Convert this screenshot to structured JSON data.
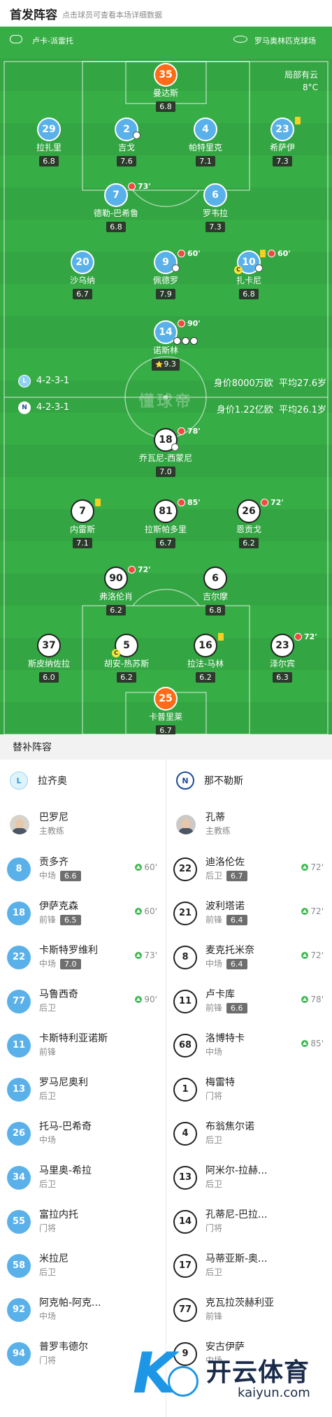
{
  "header": {
    "title": "首发阵容",
    "hint": "点击球员可查看本场详细数据"
  },
  "top_bar": {
    "coach_label": "卢卡-派雷托",
    "stadium_label": "罗马奥林匹克球场"
  },
  "weather": {
    "desc": "局部有云",
    "temp": "8°C"
  },
  "lazio_info": {
    "formation": "4-2-3-1",
    "value": "身价8000万欧",
    "age": "平均27.6岁"
  },
  "napoli_info": {
    "formation": "4-2-3-1",
    "value": "身价1.22亿欧",
    "age": "平均26.1岁"
  },
  "watermark": "懂球帝",
  "lazio_players": [
    {
      "num": "35",
      "name": "曼达斯",
      "rating": "6.8",
      "color": "orange"
    },
    {
      "num": "29",
      "name": "拉扎里",
      "rating": "6.8",
      "color": "blue"
    },
    {
      "num": "2",
      "name": "吉戈",
      "rating": "7.6",
      "color": "blue"
    },
    {
      "num": "4",
      "name": "帕特里克",
      "rating": "7.1",
      "color": "blue"
    },
    {
      "num": "23",
      "name": "希萨伊",
      "rating": "7.3",
      "color": "blue"
    },
    {
      "num": "7",
      "name": "德勒-巴希鲁",
      "rating": "6.8",
      "color": "blue",
      "sub_min": "73'"
    },
    {
      "num": "6",
      "name": "罗韦拉",
      "rating": "7.3",
      "color": "blue"
    },
    {
      "num": "20",
      "name": "沙乌纳",
      "rating": "6.7",
      "color": "blue"
    },
    {
      "num": "9",
      "name": "佩德罗",
      "rating": "7.9",
      "color": "blue",
      "sub_min": "60'"
    },
    {
      "num": "10",
      "name": "扎卡尼",
      "rating": "6.8",
      "color": "blue",
      "sub_min": "60'"
    },
    {
      "num": "14",
      "name": "诺斯林",
      "rating": "9.3",
      "color": "blue",
      "sub_min": "90'"
    }
  ],
  "napoli_players": [
    {
      "num": "18",
      "name": "乔瓦尼-西蒙尼",
      "rating": "7.0",
      "sub_min": "78'"
    },
    {
      "num": "7",
      "name": "内雷斯",
      "rating": "7.1"
    },
    {
      "num": "81",
      "name": "拉斯帕多里",
      "rating": "6.7",
      "sub_min": "85'"
    },
    {
      "num": "26",
      "name": "恩贡戈",
      "rating": "6.2",
      "sub_min": "72'"
    },
    {
      "num": "90",
      "name": "弗洛伦肖",
      "rating": "6.2",
      "sub_min": "72'"
    },
    {
      "num": "6",
      "name": "吉尔摩",
      "rating": "6.8"
    },
    {
      "num": "37",
      "name": "斯皮纳佐拉",
      "rating": "6.0"
    },
    {
      "num": "5",
      "name": "胡安-热苏斯",
      "rating": "6.2"
    },
    {
      "num": "16",
      "name": "拉法-马林",
      "rating": "6.2"
    },
    {
      "num": "23",
      "name": "泽尔宾",
      "rating": "6.3",
      "sub_min": "72'"
    },
    {
      "num": "25",
      "name": "卡普里莱",
      "rating": "6.7"
    }
  ],
  "subs_title": "替补阵容",
  "lazio": {
    "team_name": "拉齐奥",
    "logo": "lazio-crest-icon",
    "coach": {
      "name": "巴罗尼",
      "role": "主教练"
    },
    "subs": [
      {
        "num": "8",
        "name": "贡多齐",
        "pos": "中场",
        "rating": "6.6",
        "minute": "60'"
      },
      {
        "num": "18",
        "name": "伊萨克森",
        "pos": "前锋",
        "rating": "6.5",
        "minute": "60'"
      },
      {
        "num": "22",
        "name": "卡斯特罗维利",
        "pos": "中场",
        "rating": "7.0",
        "minute": "73'"
      },
      {
        "num": "77",
        "name": "马鲁西奇",
        "pos": "后卫",
        "rating": "",
        "minute": "90'"
      },
      {
        "num": "11",
        "name": "卡斯特利亚诺斯",
        "pos": "前锋",
        "rating": "",
        "minute": ""
      },
      {
        "num": "13",
        "name": "罗马尼奥利",
        "pos": "后卫",
        "rating": "",
        "minute": ""
      },
      {
        "num": "26",
        "name": "托马-巴希奇",
        "pos": "中场",
        "rating": "",
        "minute": ""
      },
      {
        "num": "34",
        "name": "马里奥-希拉",
        "pos": "后卫",
        "rating": "",
        "minute": ""
      },
      {
        "num": "55",
        "name": "富拉内托",
        "pos": "门将",
        "rating": "",
        "minute": ""
      },
      {
        "num": "58",
        "name": "米拉尼",
        "pos": "后卫",
        "rating": "",
        "minute": ""
      },
      {
        "num": "92",
        "name": "阿克帕-阿克...",
        "pos": "中场",
        "rating": "",
        "minute": ""
      },
      {
        "num": "94",
        "name": "普罗韦德尔",
        "pos": "门将",
        "rating": "",
        "minute": ""
      }
    ]
  },
  "napoli": {
    "team_name": "那不勒斯",
    "logo": "napoli-crest-icon",
    "coach": {
      "name": "孔蒂",
      "role": "主教练"
    },
    "subs": [
      {
        "num": "22",
        "name": "迪洛伦佐",
        "pos": "后卫",
        "rating": "6.7",
        "minute": "72'"
      },
      {
        "num": "21",
        "name": "波利塔诺",
        "pos": "前锋",
        "rating": "6.4",
        "minute": "72'"
      },
      {
        "num": "8",
        "name": "麦克托米奈",
        "pos": "中场",
        "rating": "6.4",
        "minute": "72'"
      },
      {
        "num": "11",
        "name": "卢卡库",
        "pos": "前锋",
        "rating": "6.6",
        "minute": "78'"
      },
      {
        "num": "68",
        "name": "洛博特卡",
        "pos": "中场",
        "rating": "",
        "minute": "85'"
      },
      {
        "num": "1",
        "name": "梅雷特",
        "pos": "门将",
        "rating": "",
        "minute": ""
      },
      {
        "num": "4",
        "name": "布翁焦尔诺",
        "pos": "后卫",
        "rating": "",
        "minute": ""
      },
      {
        "num": "13",
        "name": "阿米尔-拉赫...",
        "pos": "后卫",
        "rating": "",
        "minute": ""
      },
      {
        "num": "14",
        "name": "孔蒂尼-巴拉...",
        "pos": "门将",
        "rating": "",
        "minute": ""
      },
      {
        "num": "17",
        "name": "马蒂亚斯-奥...",
        "pos": "后卫",
        "rating": "",
        "minute": ""
      },
      {
        "num": "77",
        "name": "克瓦拉茨赫利亚",
        "pos": "前锋",
        "rating": "",
        "minute": ""
      },
      {
        "num": "9",
        "name": "安古伊萨",
        "pos": "中场",
        "rating": "",
        "minute": ""
      }
    ]
  },
  "brand": {
    "cn": "开云体育",
    "en": "kaiyun.com"
  },
  "colors": {
    "pitch": "#37ad46",
    "lazio": "#5ab1ea",
    "gk": "#ff6b17",
    "sub_in": "#3fb950"
  }
}
